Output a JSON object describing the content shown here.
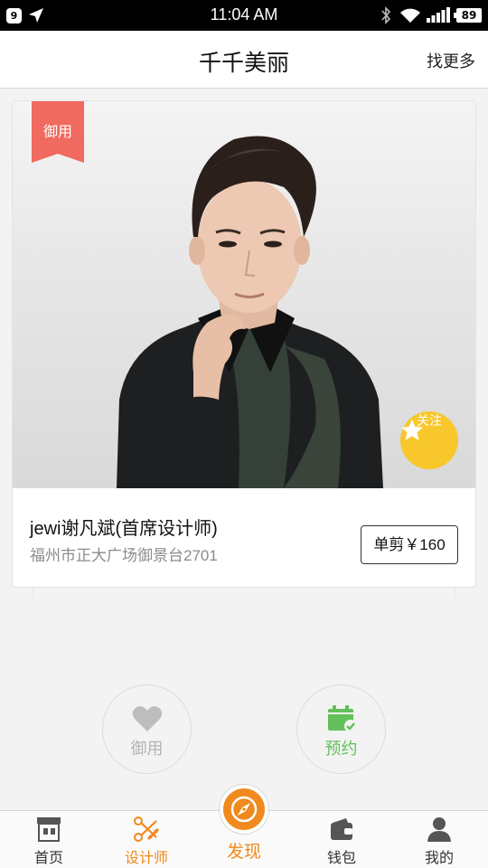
{
  "status_bar": {
    "notification_count": "9",
    "time": "11:04 AM",
    "battery": "89"
  },
  "header": {
    "title": "千千美丽",
    "more_label": "找更多"
  },
  "stylist_card": {
    "tag": "御用",
    "follow_label": "关注",
    "name": "jewi谢凡斌(首席设计师)",
    "address": "福州市正大广场御景台2701",
    "price_label": "单剪￥160"
  },
  "actions": {
    "royal_label": "御用",
    "book_label": "预约"
  },
  "tab_bar": {
    "items": [
      {
        "label": "首页",
        "icon": "storefront-icon"
      },
      {
        "label": "设计师",
        "icon": "scissors-comb-icon"
      },
      {
        "label": "发现",
        "icon": "compass-icon"
      },
      {
        "label": "钱包",
        "icon": "wallet-icon"
      },
      {
        "label": "我的",
        "icon": "user-icon"
      }
    ],
    "active_index": 1
  },
  "colors": {
    "accent_orange": "#f0891c",
    "follow_yellow": "#f7c72c",
    "tag_red": "#f06a5f",
    "book_green": "#63c05b"
  }
}
